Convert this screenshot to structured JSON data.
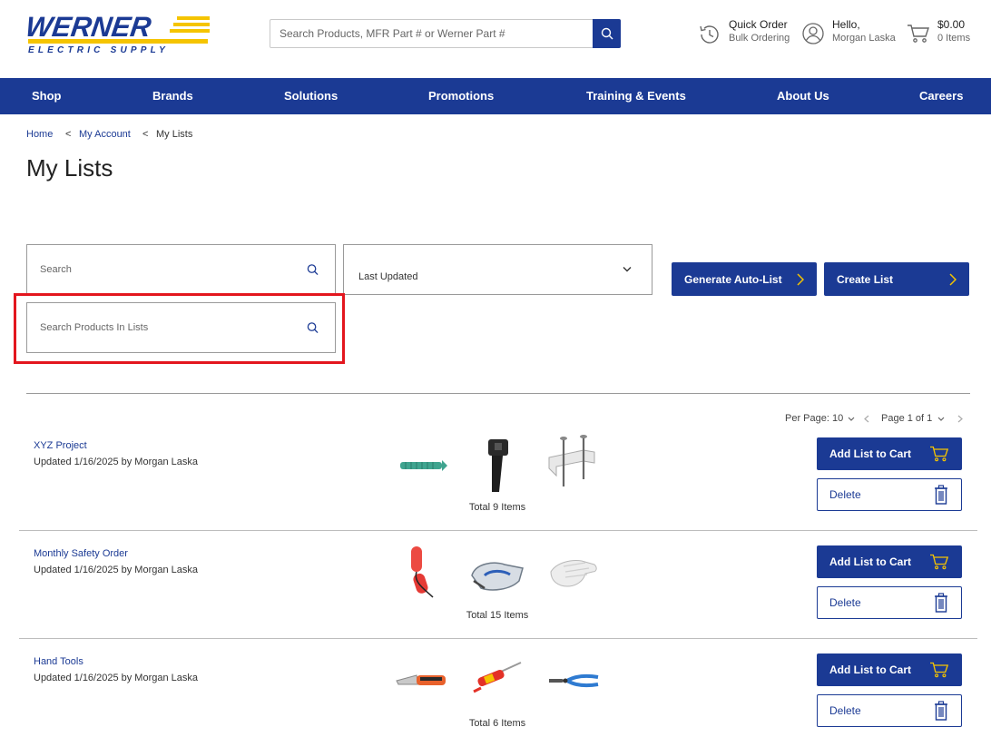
{
  "brand": {
    "name": "WERNER",
    "tagline": "ELECTRIC SUPPLY",
    "blue": "#1b3a94",
    "yellow": "#f5c400",
    "highlight": "#e3161e"
  },
  "header": {
    "search_placeholder": "Search Products, MFR Part # or Werner Part #",
    "quick_order": {
      "title": "Quick Order",
      "subtitle": "Bulk Ordering"
    },
    "account": {
      "greeting": "Hello,",
      "name": "Morgan Laska"
    },
    "cart": {
      "total": "$0.00",
      "items": "0 Items"
    }
  },
  "nav": [
    "Shop",
    "Brands",
    "Solutions",
    "Promotions",
    "Training & Events",
    "About Us",
    "Careers"
  ],
  "breadcrumb": {
    "home": "Home",
    "account": "My Account",
    "current": "My Lists",
    "sep": "<"
  },
  "page_title": "My Lists",
  "filters": {
    "search_placeholder": "Search",
    "sort_value": "Last Updated",
    "products_placeholder": "Search Products In Lists"
  },
  "actions": {
    "auto_list": "Generate Auto-List",
    "create_list": "Create List"
  },
  "pager": {
    "per_page_label": "Per Page:",
    "per_page_value": "10",
    "page_label": "Page 1 of 1"
  },
  "lists": [
    {
      "name": "XYZ Project",
      "meta": "Updated 1/16/2025 by Morgan Laska",
      "total": "Total 9 Items",
      "thumbs": [
        "wire-connector",
        "cable-tie",
        "cable-staple"
      ]
    },
    {
      "name": "Monthly Safety Order",
      "meta": "Updated 1/16/2025 by Morgan Laska",
      "total": "Total 15 Items",
      "thumbs": [
        "ear-plugs",
        "safety-glasses",
        "work-gloves"
      ]
    },
    {
      "name": "Hand Tools",
      "meta": "Updated 1/16/2025 by Morgan Laska",
      "total": "Total 6 Items",
      "thumbs": [
        "utility-knife",
        "screwdriver",
        "pliers"
      ]
    }
  ],
  "row_buttons": {
    "add": "Add List to Cart",
    "delete": "Delete"
  }
}
